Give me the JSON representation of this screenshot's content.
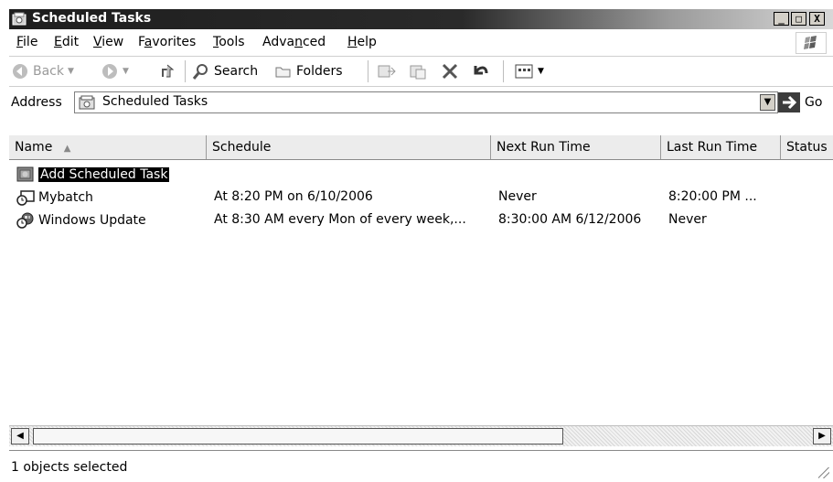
{
  "window": {
    "title": "Scheduled Tasks",
    "controls": {
      "minimize": "_",
      "maximize": "□",
      "close": "X"
    }
  },
  "menu": {
    "items": [
      {
        "pre": "",
        "key": "F",
        "post": "ile"
      },
      {
        "pre": "",
        "key": "E",
        "post": "dit"
      },
      {
        "pre": "",
        "key": "V",
        "post": "iew"
      },
      {
        "pre": "F",
        "key": "a",
        "post": "vorites"
      },
      {
        "pre": "",
        "key": "T",
        "post": "ools"
      },
      {
        "pre": "Adva",
        "key": "n",
        "post": "ced"
      },
      {
        "pre": "",
        "key": "H",
        "post": "elp"
      }
    ]
  },
  "toolbar": {
    "back_label": "Back",
    "search_label": "Search",
    "folders_label": "Folders"
  },
  "address": {
    "label": "Address",
    "value": "Scheduled Tasks",
    "go_label": "Go"
  },
  "columns": [
    "Name",
    "Schedule",
    "Next Run Time",
    "Last Run Time",
    "Status"
  ],
  "rows": [
    {
      "name": "Add Scheduled Task",
      "icon": "add-task-icon",
      "schedule": "",
      "next": "",
      "last": "",
      "status": "",
      "selected": true
    },
    {
      "name": "Mybatch",
      "icon": "clock-task-icon",
      "schedule": "At 8:20 PM on 6/10/2006",
      "next": "Never",
      "last": "8:20:00 PM  ...",
      "status": "",
      "selected": false
    },
    {
      "name": "Windows Update",
      "icon": "windows-update-icon",
      "schedule": "At 8:30 AM every Mon of every week,...",
      "next": "8:30:00 AM  6/12/2006",
      "last": "Never",
      "status": "",
      "selected": false
    }
  ],
  "status": {
    "text": "1 objects selected"
  },
  "colors": {
    "title_bar_dark": "#1e1e1e",
    "selection": "#000000"
  }
}
